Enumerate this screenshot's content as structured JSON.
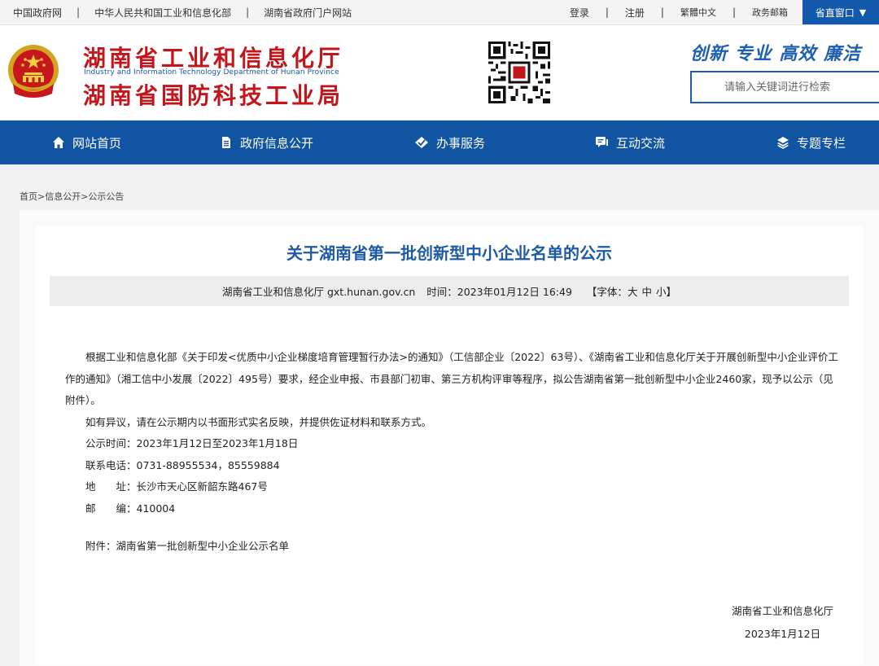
{
  "topbar": {
    "links": [
      "中国政府网",
      "中华人民共和国工业和信息化部",
      "湖南省政府门户网站"
    ],
    "login": "登录",
    "register": "注册",
    "traditional": "繁體中文",
    "mail": "政务邮箱",
    "province_window": "省直窗口",
    "dropdown_arrow": "▼"
  },
  "header": {
    "logo_line1": "湖南省工业和信息化厅",
    "logo_en": "Industry and Information Technology Department of Hunan Province",
    "logo_line2": "湖南省国防科技工业局",
    "slogan": "创新  专业  高效  廉洁",
    "search_placeholder": "请输入关键词进行检索",
    "emblem_icon": "national-emblem-icon",
    "qr_icon": "qr-code-icon"
  },
  "nav": [
    {
      "label": "网站首页",
      "icon": "home-icon"
    },
    {
      "label": "政府信息公开",
      "icon": "document-icon"
    },
    {
      "label": "办事服务",
      "icon": "service-diamond-icon"
    },
    {
      "label": "互动交流",
      "icon": "chat-icon"
    },
    {
      "label": "专题专栏",
      "icon": "layers-icon"
    }
  ],
  "breadcrumb": "首页>信息公开>公示公告",
  "article": {
    "title": "关于湖南省第一批创新型中小企业名单的公示",
    "source": "湖南省工业和信息化厅 gxt.hunan.gov.cn",
    "time_label": "时间：",
    "time_value": "2023年01月12日 16:49",
    "font_label": "【字体：",
    "font_large": "大",
    "font_medium": "中",
    "font_small": "小",
    "font_close": "】",
    "paragraph1": "根据工业和信息化部《关于印发<优质中小企业梯度培育管理暂行办法>的通知》（工信部企业〔2022〕63号）、《湖南省工业和信息化厅关于开展创新型中小企业评价工作的通知》（湘工信中小发展〔2022〕495号）要求，经企业申报、市县部门初审、第三方机构评审等程序，拟公告湖南省第一批创新型中小企业2460家，现予以公示（见附件）。",
    "paragraph2": "如有异议，请在公示期内以书面形式实名反映，并提供佐证材料和联系方式。",
    "period": "公示时间：2023年1月12日至2023年1月18日",
    "phone": "联系电话：0731-88955534，85559884",
    "address": "地　　址：长沙市天心区新韶东路467号",
    "postcode": "邮　　编：410004",
    "attachment_label": "附件：",
    "attachment_link": "湖南省第一批创新型中小企业公示名单",
    "sign_org": "湖南省工业和信息化厅",
    "sign_date": "2023年1月12日"
  },
  "colors": {
    "brand_red": "#c3161c",
    "brand_blue": "#1154a2",
    "title_blue": "#1d5aa6"
  }
}
